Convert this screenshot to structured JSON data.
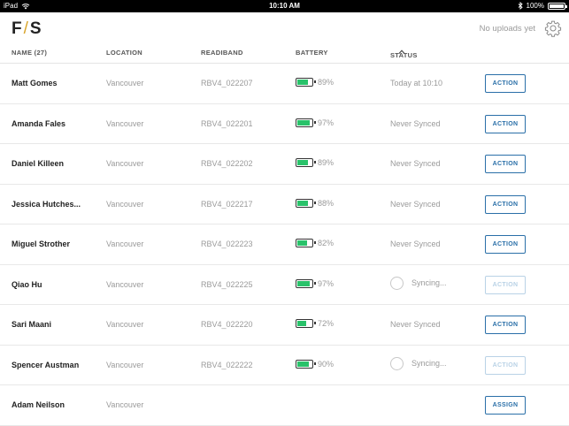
{
  "status_bar": {
    "device": "iPad",
    "time": "10:10 AM",
    "battery": "100%"
  },
  "header": {
    "logo_left": "F",
    "logo_sep": "/",
    "logo_right": "S",
    "uploads_text": "No uploads yet"
  },
  "columns": {
    "name": "NAME (27)",
    "location": "LOCATION",
    "readiband": "READIBAND",
    "battery": "BATTERY",
    "status": "STATUS"
  },
  "rows": [
    {
      "name": "Matt Gomes",
      "location": "Vancouver",
      "readiband": "RBV4_022207",
      "battery": "89%",
      "battery_level": 0.89,
      "status": "Today at 10:10",
      "syncing": false,
      "action": "ACTION",
      "action_enabled": true
    },
    {
      "name": "Amanda Fales",
      "location": "Vancouver",
      "readiband": "RBV4_022201",
      "battery": "97%",
      "battery_level": 0.97,
      "status": "Never Synced",
      "syncing": false,
      "action": "ACTION",
      "action_enabled": true
    },
    {
      "name": "Daniel Killeen",
      "location": "Vancouver",
      "readiband": "RBV4_022202",
      "battery": "89%",
      "battery_level": 0.89,
      "status": "Never Synced",
      "syncing": false,
      "action": "ACTION",
      "action_enabled": true
    },
    {
      "name": "Jessica Hutches...",
      "location": "Vancouver",
      "readiband": "RBV4_022217",
      "battery": "88%",
      "battery_level": 0.88,
      "status": "Never Synced",
      "syncing": false,
      "action": "ACTION",
      "action_enabled": true
    },
    {
      "name": "Miguel Strother",
      "location": "Vancouver",
      "readiband": "RBV4_022223",
      "battery": "82%",
      "battery_level": 0.82,
      "status": "Never Synced",
      "syncing": false,
      "action": "ACTION",
      "action_enabled": true
    },
    {
      "name": "Qiao Hu",
      "location": "Vancouver",
      "readiband": "RBV4_022225",
      "battery": "97%",
      "battery_level": 0.97,
      "status": "Syncing...",
      "syncing": true,
      "action": "ACTION",
      "action_enabled": false
    },
    {
      "name": "Sari Maani",
      "location": "Vancouver",
      "readiband": "RBV4_022220",
      "battery": "72%",
      "battery_level": 0.72,
      "status": "Never Synced",
      "syncing": false,
      "action": "ACTION",
      "action_enabled": true
    },
    {
      "name": "Spencer Austman",
      "location": "Vancouver",
      "readiband": "RBV4_022222",
      "battery": "90%",
      "battery_level": 0.9,
      "status": "Syncing...",
      "syncing": true,
      "action": "ACTION",
      "action_enabled": false
    },
    {
      "name": "Adam Neilson",
      "location": "Vancouver",
      "readiband": "",
      "battery": "",
      "battery_level": null,
      "status": "",
      "syncing": false,
      "action": "ASSIGN",
      "action_enabled": true
    }
  ]
}
